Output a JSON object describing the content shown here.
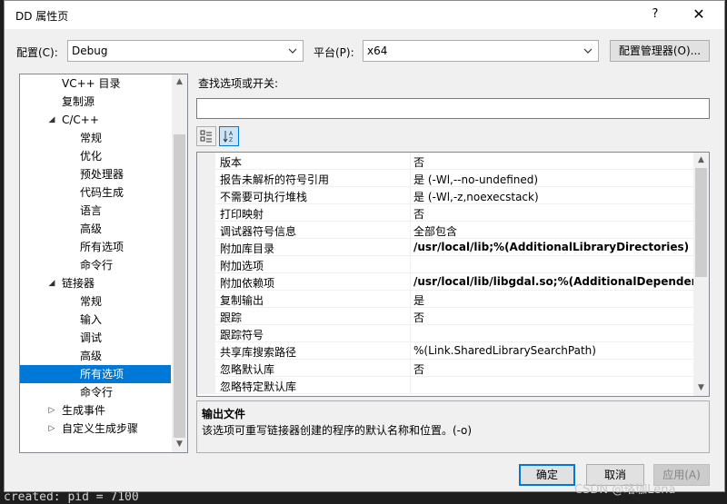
{
  "window": {
    "title": "DD 属性页",
    "help": "?",
    "close": "✕"
  },
  "config": {
    "label": "配置(C):",
    "value": "Debug",
    "platform_label": "平台(P):",
    "platform_value": "x64",
    "manager_button": "配置管理器(O)..."
  },
  "tree": {
    "items": [
      {
        "label": "VC++ 目录",
        "indent": 2,
        "twisty": ""
      },
      {
        "label": "复制源",
        "indent": 2,
        "twisty": ""
      },
      {
        "label": "C/C++",
        "indent": 2,
        "twisty": "◢"
      },
      {
        "label": "常规",
        "indent": 3,
        "twisty": ""
      },
      {
        "label": "优化",
        "indent": 3,
        "twisty": ""
      },
      {
        "label": "预处理器",
        "indent": 3,
        "twisty": ""
      },
      {
        "label": "代码生成",
        "indent": 3,
        "twisty": ""
      },
      {
        "label": "语言",
        "indent": 3,
        "twisty": ""
      },
      {
        "label": "高级",
        "indent": 3,
        "twisty": ""
      },
      {
        "label": "所有选项",
        "indent": 3,
        "twisty": ""
      },
      {
        "label": "命令行",
        "indent": 3,
        "twisty": ""
      },
      {
        "label": "链接器",
        "indent": 2,
        "twisty": "◢"
      },
      {
        "label": "常规",
        "indent": 3,
        "twisty": ""
      },
      {
        "label": "输入",
        "indent": 3,
        "twisty": ""
      },
      {
        "label": "调试",
        "indent": 3,
        "twisty": ""
      },
      {
        "label": "高级",
        "indent": 3,
        "twisty": ""
      },
      {
        "label": "所有选项",
        "indent": 3,
        "twisty": "",
        "selected": true
      },
      {
        "label": "命令行",
        "indent": 3,
        "twisty": ""
      },
      {
        "label": "生成事件",
        "indent": 2,
        "twisty": "▷"
      },
      {
        "label": "自定义生成步骤",
        "indent": 2,
        "twisty": "▷"
      }
    ]
  },
  "search": {
    "label": "查找选项或开关:",
    "value": ""
  },
  "toolbar": {
    "categorized_icon": "categorized-icon",
    "alphabetical_icon": "alphabetical-sort-icon"
  },
  "grid": {
    "rows": [
      {
        "name": "版本",
        "value": "否",
        "bold": false
      },
      {
        "name": "报告未解析的符号引用",
        "value": "是 (-Wl,--no-undefined)",
        "bold": false
      },
      {
        "name": "不需要可执行堆栈",
        "value": "是 (-Wl,-z,noexecstack)",
        "bold": false
      },
      {
        "name": "打印映射",
        "value": "否",
        "bold": false
      },
      {
        "name": "调试器符号信息",
        "value": "全部包含",
        "bold": false
      },
      {
        "name": "附加库目录",
        "value": "/usr/local/lib;%(AdditionalLibraryDirectories)",
        "bold": true
      },
      {
        "name": "附加选项",
        "value": "",
        "bold": false
      },
      {
        "name": "附加依赖项",
        "value": "/usr/local/lib/libgdal.so;%(AdditionalDependencies)",
        "bold": true
      },
      {
        "name": "复制输出",
        "value": "是",
        "bold": false
      },
      {
        "name": "跟踪",
        "value": "否",
        "bold": false
      },
      {
        "name": "跟踪符号",
        "value": "",
        "bold": false
      },
      {
        "name": "共享库搜索路径",
        "value": "%(Link.SharedLibrarySearchPath)",
        "bold": false
      },
      {
        "name": "忽略默认库",
        "value": "否",
        "bold": false
      },
      {
        "name": "忽略特定默认库",
        "value": "",
        "bold": false
      }
    ]
  },
  "description": {
    "title": "输出文件",
    "text": "该选项可重写链接器创建的程序的默认名称和位置。(-o)"
  },
  "buttons": {
    "ok": "确定",
    "cancel": "取消",
    "apply": "应用(A)"
  },
  "watermark": "CSDN @珞珈Lena",
  "background_text": "created: pid = 7100"
}
